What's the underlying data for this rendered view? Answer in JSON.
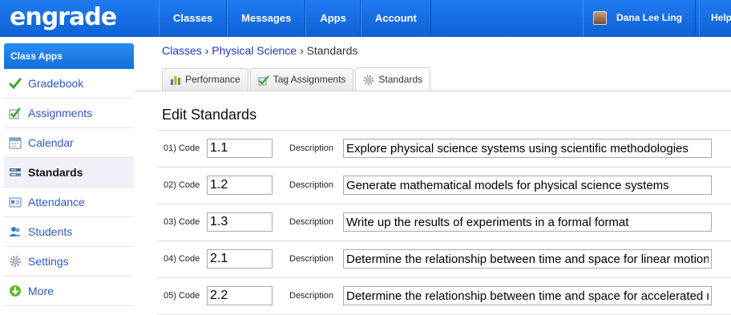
{
  "app": {
    "logo": "engrade"
  },
  "topnav": {
    "items": [
      {
        "label": "Classes"
      },
      {
        "label": "Messages"
      },
      {
        "label": "Apps"
      },
      {
        "label": "Account"
      }
    ],
    "user_name": "Dana Lee Ling",
    "help_label": "Help"
  },
  "sidebar": {
    "header": "Class Apps",
    "items": [
      {
        "label": "Gradebook",
        "icon": "checkmark-icon"
      },
      {
        "label": "Assignments",
        "icon": "assignments-icon"
      },
      {
        "label": "Calendar",
        "icon": "calendar-icon"
      },
      {
        "label": "Standards",
        "icon": "standards-icon",
        "active": true
      },
      {
        "label": "Attendance",
        "icon": "attendance-icon"
      },
      {
        "label": "Students",
        "icon": "students-icon"
      },
      {
        "label": "Settings",
        "icon": "gear-icon"
      },
      {
        "label": "More",
        "icon": "arrow-down-icon"
      }
    ]
  },
  "breadcrumb": {
    "classes": "Classes",
    "sep1": "›",
    "course": "Physical Science",
    "sep2": "›",
    "current": "Standards"
  },
  "tabs": [
    {
      "label": "Performance",
      "icon": "bar-chart-icon"
    },
    {
      "label": "Tag Assignments",
      "icon": "tag-icon"
    },
    {
      "label": "Standards",
      "icon": "gear-icon",
      "active": true
    }
  ],
  "main": {
    "title": "Edit Standards",
    "code_label_suffix": "Code",
    "description_label": "Description",
    "rows": [
      {
        "num": "01)",
        "code": "1.1",
        "description": "Explore physical science systems using scientific methodologies"
      },
      {
        "num": "02)",
        "code": "1.2",
        "description": "Generate mathematical models for physical science systems"
      },
      {
        "num": "03)",
        "code": "1.3",
        "description": "Write up the results of experiments in a formal format"
      },
      {
        "num": "04)",
        "code": "2.1",
        "description": "Determine the relationship between time and space for linear motion"
      },
      {
        "num": "05)",
        "code": "2.2",
        "description": "Determine the relationship between time and space for accelerated motion"
      }
    ]
  },
  "colors": {
    "topbar": "#1f7af0",
    "link": "#2f57c4",
    "active_bg": "#f0f1f8"
  }
}
